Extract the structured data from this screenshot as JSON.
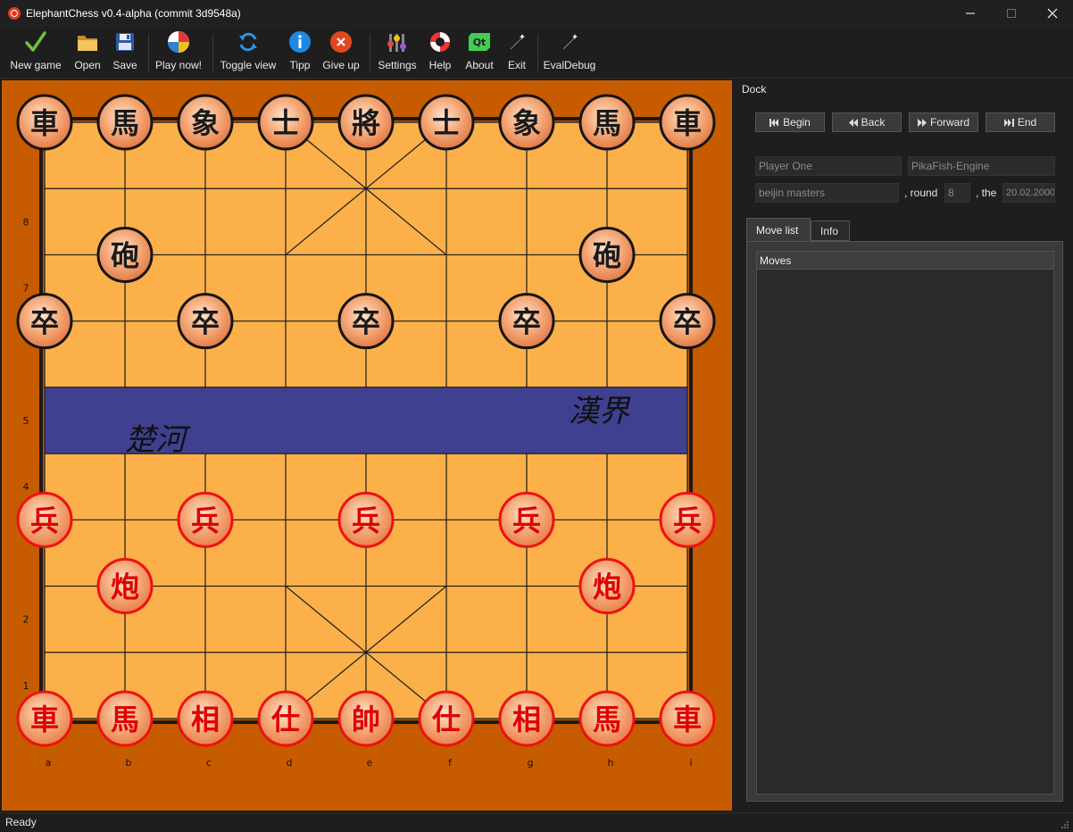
{
  "window": {
    "title": "ElephantChess v0.4-alpha (commit 3d9548a)"
  },
  "toolbar": [
    {
      "id": "new-game",
      "label": "New game",
      "icon": "check-icon"
    },
    {
      "id": "open",
      "label": "Open",
      "icon": "folder-icon"
    },
    {
      "id": "save",
      "label": "Save",
      "icon": "floppy-icon"
    },
    {
      "id": "play-now",
      "label": "Play now!",
      "icon": "beachball-icon"
    },
    {
      "id": "toggle-view",
      "label": "Toggle view",
      "icon": "refresh-icon"
    },
    {
      "id": "tipp",
      "label": "Tipp",
      "icon": "info-icon"
    },
    {
      "id": "give-up",
      "label": "Give up",
      "icon": "close-circle-icon"
    },
    {
      "id": "settings",
      "label": "Settings",
      "icon": "sliders-icon"
    },
    {
      "id": "help",
      "label": "Help",
      "icon": "lifebuoy-icon"
    },
    {
      "id": "about",
      "label": "About",
      "icon": "qt-icon"
    },
    {
      "id": "exit",
      "label": "Exit",
      "icon": "wand-icon"
    },
    {
      "id": "eval-debug",
      "label": "EvalDebug",
      "icon": "wand-icon"
    }
  ],
  "board": {
    "rank_labels": [
      "8",
      "7",
      "5",
      "4",
      "2",
      "1"
    ],
    "file_labels": [
      "a",
      "b",
      "c",
      "d",
      "e",
      "f",
      "g",
      "h",
      "i"
    ],
    "river_left": "楚河",
    "river_right": "漢界",
    "colors": {
      "frame": "#c75b00",
      "board": "#fbb04a",
      "river": "#3f408f",
      "black_piece": "#1a1a1a",
      "red_piece": "#e00000"
    },
    "pieces": [
      {
        "side": "black",
        "char": "車",
        "file": 0,
        "rank": 9
      },
      {
        "side": "black",
        "char": "馬",
        "file": 1,
        "rank": 9
      },
      {
        "side": "black",
        "char": "象",
        "file": 2,
        "rank": 9
      },
      {
        "side": "black",
        "char": "士",
        "file": 3,
        "rank": 9
      },
      {
        "side": "black",
        "char": "將",
        "file": 4,
        "rank": 9
      },
      {
        "side": "black",
        "char": "士",
        "file": 5,
        "rank": 9
      },
      {
        "side": "black",
        "char": "象",
        "file": 6,
        "rank": 9
      },
      {
        "side": "black",
        "char": "馬",
        "file": 7,
        "rank": 9
      },
      {
        "side": "black",
        "char": "車",
        "file": 8,
        "rank": 9
      },
      {
        "side": "black",
        "char": "砲",
        "file": 1,
        "rank": 7
      },
      {
        "side": "black",
        "char": "砲",
        "file": 7,
        "rank": 7
      },
      {
        "side": "black",
        "char": "卒",
        "file": 0,
        "rank": 6
      },
      {
        "side": "black",
        "char": "卒",
        "file": 2,
        "rank": 6
      },
      {
        "side": "black",
        "char": "卒",
        "file": 4,
        "rank": 6
      },
      {
        "side": "black",
        "char": "卒",
        "file": 6,
        "rank": 6
      },
      {
        "side": "black",
        "char": "卒",
        "file": 8,
        "rank": 6
      },
      {
        "side": "red",
        "char": "兵",
        "file": 0,
        "rank": 3
      },
      {
        "side": "red",
        "char": "兵",
        "file": 2,
        "rank": 3
      },
      {
        "side": "red",
        "char": "兵",
        "file": 4,
        "rank": 3
      },
      {
        "side": "red",
        "char": "兵",
        "file": 6,
        "rank": 3
      },
      {
        "side": "red",
        "char": "兵",
        "file": 8,
        "rank": 3
      },
      {
        "side": "red",
        "char": "炮",
        "file": 1,
        "rank": 2
      },
      {
        "side": "red",
        "char": "炮",
        "file": 7,
        "rank": 2
      },
      {
        "side": "red",
        "char": "車",
        "file": 0,
        "rank": 0
      },
      {
        "side": "red",
        "char": "馬",
        "file": 1,
        "rank": 0
      },
      {
        "side": "red",
        "char": "相",
        "file": 2,
        "rank": 0
      },
      {
        "side": "red",
        "char": "仕",
        "file": 3,
        "rank": 0
      },
      {
        "side": "red",
        "char": "帥",
        "file": 4,
        "rank": 0
      },
      {
        "side": "red",
        "char": "仕",
        "file": 5,
        "rank": 0
      },
      {
        "side": "red",
        "char": "相",
        "file": 6,
        "rank": 0
      },
      {
        "side": "red",
        "char": "馬",
        "file": 7,
        "rank": 0
      },
      {
        "side": "red",
        "char": "車",
        "file": 8,
        "rank": 0
      }
    ]
  },
  "dock": {
    "title": "Dock",
    "nav": {
      "begin": "Begin",
      "back": "Back",
      "forward": "Forward",
      "end": "End"
    },
    "player_one": "Player One",
    "player_two": "PikaFish-Engine",
    "event": "beijin masters",
    "round_label": ", round",
    "round": "8",
    "date_label": ", the",
    "date": "20.02.2000",
    "tabs": {
      "moves": "Move list",
      "info": "Info"
    },
    "moves_header": "Moves"
  },
  "status": {
    "text": "Ready"
  }
}
